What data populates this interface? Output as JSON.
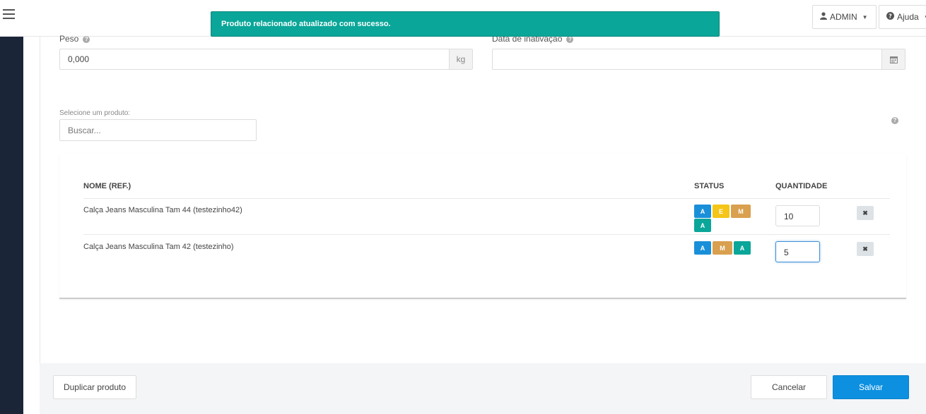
{
  "toast": {
    "message": "Produto relacionado atualizado com sucesso."
  },
  "header": {
    "admin_label": "ADMIN",
    "help_label": "Ajuda"
  },
  "form": {
    "weight": {
      "label": "Peso",
      "value": "0,000",
      "unit": "kg"
    },
    "inactivation_date": {
      "label": "Data de inativação",
      "value": ""
    },
    "product_select": {
      "label": "Selecione um produto:",
      "placeholder": "Buscar..."
    }
  },
  "table": {
    "headers": {
      "name": "NOME (REF.)",
      "status": "STATUS",
      "quantity": "QUANTIDADE"
    },
    "rows": [
      {
        "name": "Calça Jeans Masculina Tam 44 (testezinho42)",
        "badges": [
          {
            "text": "A",
            "color": "#1a8fd9"
          },
          {
            "text": "E",
            "color": "#f5c518"
          },
          {
            "text": "M",
            "color": "#d9a04f"
          },
          {
            "text": "A",
            "color": "#0aa699"
          }
        ],
        "quantity": "10"
      },
      {
        "name": "Calça Jeans Masculina Tam 42 (testezinho)",
        "badges": [
          {
            "text": "A",
            "color": "#1a8fd9"
          },
          {
            "text": "M",
            "color": "#d9a04f"
          },
          {
            "text": "A",
            "color": "#0aa699"
          }
        ],
        "quantity": "5"
      }
    ]
  },
  "footer": {
    "duplicate_label": "Duplicar produto",
    "cancel_label": "Cancelar",
    "save_label": "Salvar"
  },
  "colors": {
    "accent": "#0d90e0",
    "success": "#0aa699",
    "sidebar": "#1b2538"
  }
}
